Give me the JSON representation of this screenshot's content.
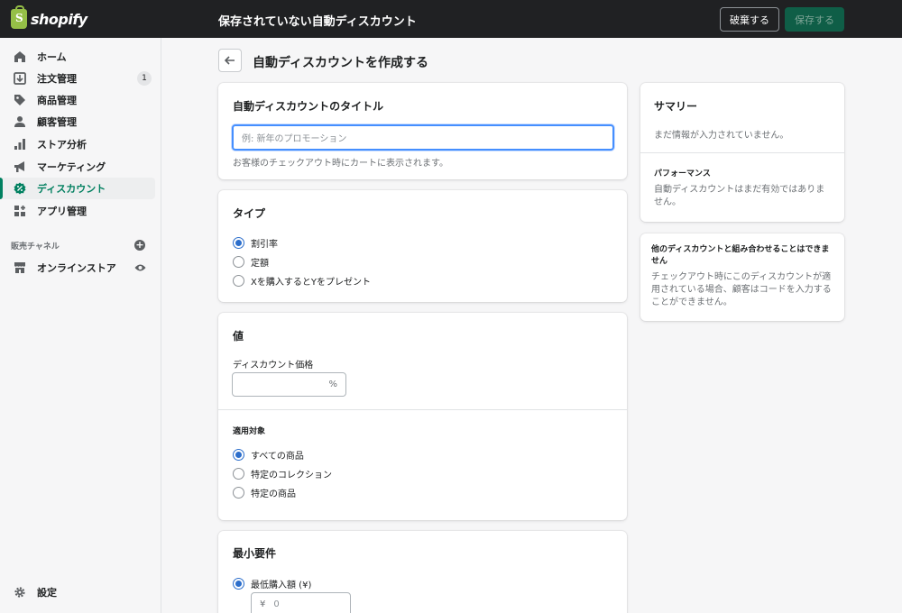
{
  "topbar": {
    "logo_text": "shopify",
    "title": "保存されていない自動ディスカウント",
    "discard_label": "破棄する",
    "save_label": "保存する"
  },
  "sidebar": {
    "items": [
      {
        "label": "ホーム",
        "icon": "home-icon"
      },
      {
        "label": "注文管理",
        "icon": "orders-icon",
        "badge": "1"
      },
      {
        "label": "商品管理",
        "icon": "tag-icon"
      },
      {
        "label": "顧客管理",
        "icon": "person-icon"
      },
      {
        "label": "ストア分析",
        "icon": "analytics-icon"
      },
      {
        "label": "マーケティング",
        "icon": "megaphone-icon"
      },
      {
        "label": "ディスカウント",
        "icon": "discount-icon",
        "active": true
      },
      {
        "label": "アプリ管理",
        "icon": "apps-icon"
      }
    ],
    "channels_label": "販売チャネル",
    "online_store_label": "オンラインストア",
    "settings_label": "設定"
  },
  "page": {
    "title": "自動ディスカウントを作成する"
  },
  "title_card": {
    "title": "自動ディスカウントのタイトル",
    "input_placeholder": "例: 新年のプロモーション",
    "help": "お客様のチェックアウト時にカートに表示されます。"
  },
  "type_card": {
    "title": "タイプ",
    "options": [
      "割引率",
      "定額",
      "Xを購入するとYをプレゼント"
    ],
    "selected_index": 0
  },
  "value_card": {
    "title": "値",
    "price_label": "ディスカウント価格",
    "price_suffix": "%",
    "applies_label": "適用対象",
    "applies_options": [
      "すべての商品",
      "特定のコレクション",
      "特定の商品"
    ],
    "applies_selected_index": 0
  },
  "min_card": {
    "title": "最小要件",
    "option_label": "最低購入額 (¥)",
    "currency_symbol": "¥",
    "amount_value": "0"
  },
  "summary_card": {
    "title": "サマリー",
    "empty_text": "まだ情報が入力されていません。",
    "performance_title": "パフォーマンス",
    "performance_text": "自動ディスカウントはまだ有効ではありません。"
  },
  "combine_card": {
    "title": "他のディスカウントと組み合わせることはできません",
    "text": "チェックアウト時にこのディスカウントが適用されている場合、顧客はコードを入力することができません。"
  }
}
